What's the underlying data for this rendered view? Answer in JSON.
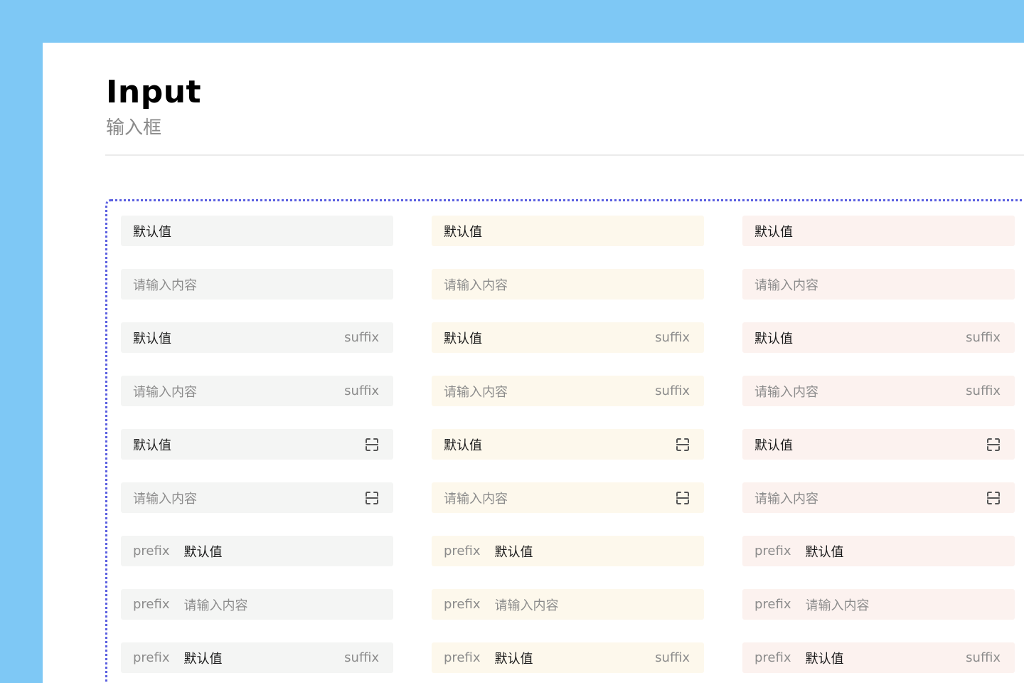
{
  "header": {
    "title": "Input",
    "subtitle": "输入框"
  },
  "icons": {
    "scan": "scan-icon"
  },
  "colors": {
    "background": "#7ec8f5",
    "accent_dotted": "#5b5fe0",
    "gray_field": "#f4f5f4",
    "yellow_field": "#fdf8ec",
    "pink_field": "#fcf2ef"
  },
  "labels": {
    "value": "默认值",
    "placeholder": "请输入内容",
    "suffix": "suffix",
    "prefix": "prefix"
  },
  "columns": [
    {
      "theme": "gray"
    },
    {
      "theme": "yellow"
    },
    {
      "theme": "pink"
    }
  ]
}
